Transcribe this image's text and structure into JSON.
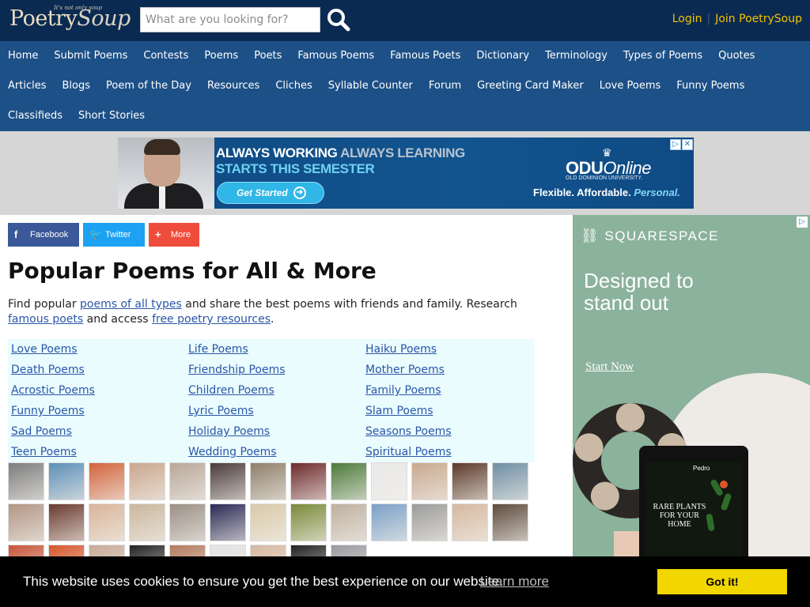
{
  "header": {
    "logo_word_a": "Poetry",
    "logo_word_b": "Soup",
    "logo_tagline": "It's not only soup",
    "search_placeholder": "What are you looking for?",
    "search_icon": "search-icon",
    "login": "Login",
    "separator": "|",
    "join": "Join PoetrySoup",
    "colors": {
      "background": "#0b2a52",
      "accent": "#f2c200"
    }
  },
  "nav": {
    "row1": [
      "Home",
      "Submit Poems",
      "Contests",
      "Poems",
      "Poets",
      "Famous Poems",
      "Famous Poets",
      "Dictionary",
      "Terminology",
      "Types of Poems",
      "Quotes"
    ],
    "row2": [
      "Articles",
      "Blogs",
      "Poem of the Day",
      "Resources",
      "Cliches",
      "Syllable Counter",
      "Forum",
      "Greeting Card Maker",
      "Love Poems",
      "Funny Poems"
    ],
    "row3": [
      "Classifieds",
      "Short Stories"
    ],
    "background": "#1d5087"
  },
  "banner_ad": {
    "line1_a": "ALWAYS WORKING",
    "line1_b": "ALWAYS LEARNING",
    "line2": "STARTS THIS SEMESTER",
    "cta": "Get Started",
    "brand_a": "ODU",
    "brand_b": "Online",
    "brand_sub": "OLD DOMINION UNIVERSITY.",
    "slogan_a": "Flexible. Affordable.",
    "slogan_b": "Personal.",
    "adchoices_icon": "adchoices-icon",
    "close_icon": "close-icon"
  },
  "share": {
    "facebook": "Facebook",
    "twitter": "Twitter",
    "more": "More"
  },
  "main": {
    "title": "Popular Poems for All & More",
    "intro_1": "Find popular ",
    "intro_link_1": "poems of all types",
    "intro_2": " and share the best poems with friends and family. Research ",
    "intro_link_2": "famous poets",
    "intro_3": " and access ",
    "intro_link_3": "free poetry resources",
    "intro_4": ".",
    "categories": [
      [
        "Love Poems",
        "Death Poems",
        "Acrostic Poems",
        "Funny Poems",
        "Sad Poems",
        "Teen Poems"
      ],
      [
        "Life Poems",
        "Friendship Poems",
        "Children Poems",
        "Lyric Poems",
        "Holiday Poems",
        "Wedding Poems"
      ],
      [
        "Haiku Poems",
        "Mother Poems",
        "Family Poems",
        "Slam Poems",
        "Seasons Poems",
        "Spiritual Poems"
      ]
    ]
  },
  "avatars": {
    "row1": [
      "#7d7d7d",
      "#5d8fb7",
      "#d2643c",
      "#c9a78e",
      "#b9a79a",
      "#4a3b3a",
      "#8f7f6a",
      "#6e2a2d",
      "#4d7a3c",
      "#e9e9e9",
      "#c8a88e",
      "#5b3a2a",
      "#6f8ea5"
    ],
    "row2": [
      "#b29585",
      "#6a3a2f",
      "#d8b59a",
      "#c9b79e",
      "#9a8f85",
      "#2a2a55",
      "#d9c9a9",
      "#7a8a3a",
      "#bfb0a0",
      "#7aa0c8",
      "#9b9b9b",
      "#d5b8a0",
      "#5d4a3d"
    ],
    "row3": [
      "#c8553a",
      "#d5562b",
      "#c9aa98",
      "#222222",
      "#b47a5f",
      "#e3e3e3",
      "#d7b8a0",
      "#222222",
      "#9a9aa0"
    ]
  },
  "side_ad": {
    "brand": "SQUARESPACE",
    "headline": "Designed to stand out",
    "cta": "Start Now",
    "tablet_brand": "Pedro",
    "tablet_text": "RARE PLANTS FOR YOUR HOME",
    "background": "#8bb29b"
  },
  "cookie": {
    "message": "This website uses cookies to ensure you get the best experience on our website.",
    "learn_more": "Learn more",
    "button": "Got it!",
    "button_color": "#f1d600"
  }
}
